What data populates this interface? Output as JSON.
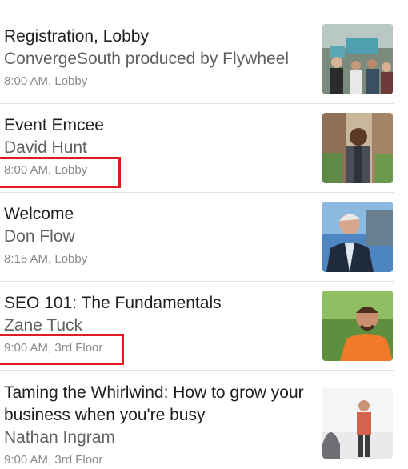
{
  "sessions": [
    {
      "title": "Registration, Lobby",
      "speaker": "ConvergeSouth produced by Flywheel",
      "meta": "8:00 AM, Lobby",
      "image": "registration-crowd-photo"
    },
    {
      "title": "Event Emcee",
      "speaker": "David Hunt",
      "meta": "8:00 AM, Lobby",
      "image": "emcee-portrait-photo",
      "highlighted": true
    },
    {
      "title": "Welcome",
      "speaker": "Don Flow",
      "meta": "8:15 AM, Lobby",
      "image": "welcome-speaker-photo"
    },
    {
      "title": "SEO 101: The Fundamentals",
      "speaker": "Zane Tuck",
      "meta": "9:00 AM, 3rd Floor",
      "image": "seo-speaker-photo",
      "highlighted": true
    },
    {
      "title": "Taming the Whirlwind: How to grow your business when you're busy",
      "speaker": "Nathan Ingram",
      "meta": "9:00 AM, 3rd Floor",
      "image": "presenter-stage-photo"
    }
  ],
  "colors": {
    "highlight": "#e21b23",
    "title": "#1f1f1f",
    "speaker": "#5f6063",
    "meta": "#8a8a8a"
  }
}
